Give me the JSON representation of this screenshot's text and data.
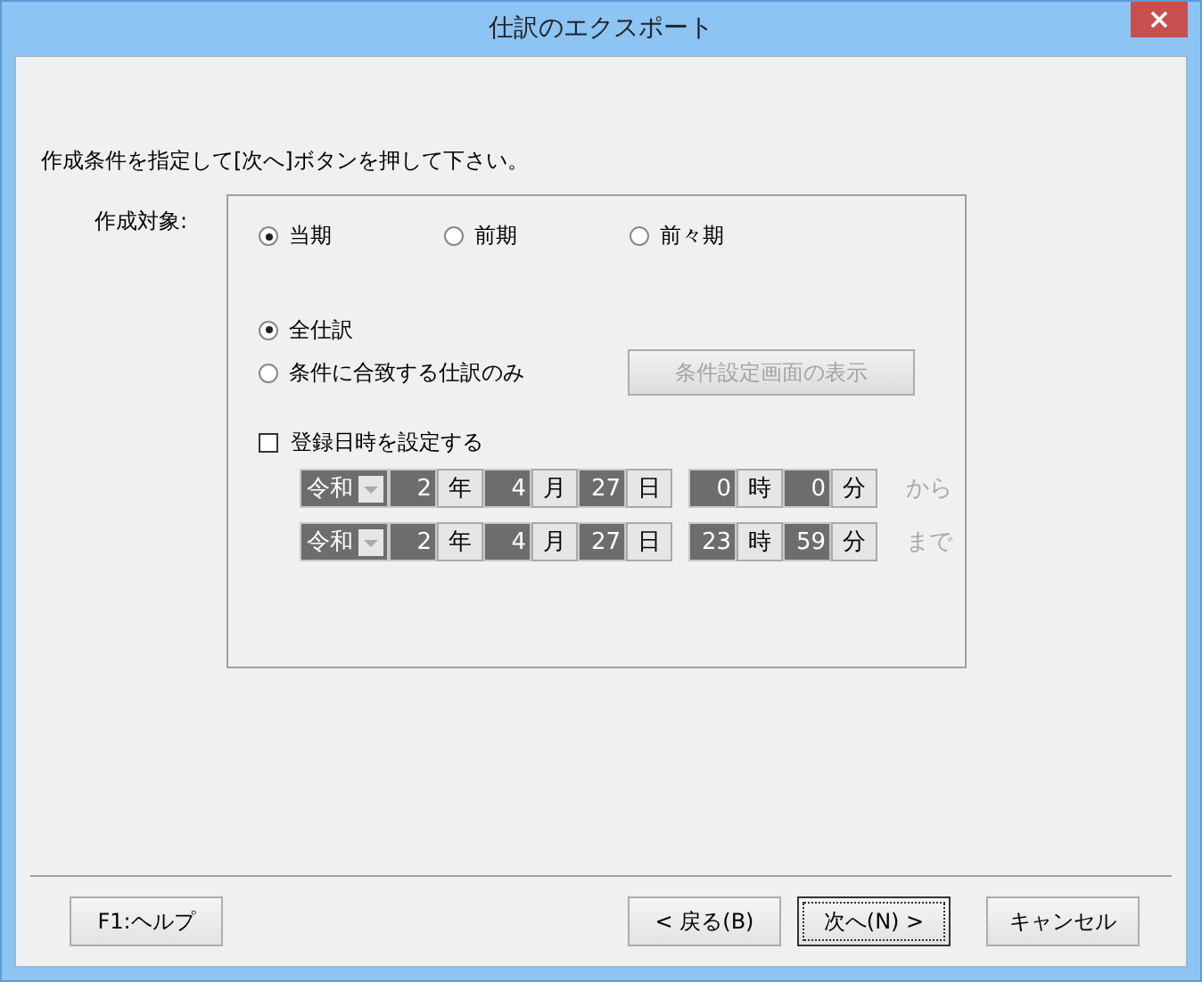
{
  "window": {
    "title": "仕訳のエクスポート"
  },
  "instruction": "作成条件を指定して[次へ]ボタンを押して下さい。",
  "target_label": "作成対象:",
  "period_options": [
    {
      "label": "当期",
      "selected": true
    },
    {
      "label": "前期",
      "selected": false
    },
    {
      "label": "前々期",
      "selected": false
    }
  ],
  "scope_options": [
    {
      "label": "全仕訳",
      "selected": true
    },
    {
      "label": "条件に合致する仕訳のみ",
      "selected": false
    }
  ],
  "condition_button": {
    "label": "条件設定画面の表示",
    "disabled": true
  },
  "date_checkbox": {
    "label": "登録日時を設定する",
    "checked": false
  },
  "date_rows": [
    {
      "date": [
        {
          "kind": "combo",
          "text": "令和"
        },
        {
          "kind": "value",
          "text": "2"
        },
        {
          "kind": "unit",
          "text": "年"
        },
        {
          "kind": "value",
          "text": "4"
        },
        {
          "kind": "unit",
          "text": "月"
        },
        {
          "kind": "value",
          "text": "27"
        },
        {
          "kind": "unit",
          "text": "日"
        }
      ],
      "time": [
        {
          "kind": "value",
          "text": "0"
        },
        {
          "kind": "unit",
          "text": "時"
        },
        {
          "kind": "value",
          "text": "0"
        },
        {
          "kind": "unit",
          "text": "分"
        }
      ],
      "suffix": "から"
    },
    {
      "date": [
        {
          "kind": "combo",
          "text": "令和"
        },
        {
          "kind": "value",
          "text": "2"
        },
        {
          "kind": "unit",
          "text": "年"
        },
        {
          "kind": "value",
          "text": "4"
        },
        {
          "kind": "unit",
          "text": "月"
        },
        {
          "kind": "value",
          "text": "27"
        },
        {
          "kind": "unit",
          "text": "日"
        }
      ],
      "time": [
        {
          "kind": "value",
          "text": "23"
        },
        {
          "kind": "unit",
          "text": "時"
        },
        {
          "kind": "value",
          "text": "59"
        },
        {
          "kind": "unit",
          "text": "分"
        }
      ],
      "suffix": "まで"
    }
  ],
  "buttons_left": [
    {
      "label": "F1:ヘルプ",
      "default": false
    }
  ],
  "buttons_right": [
    {
      "label": "< 戻る(B)",
      "default": false
    },
    {
      "label": "次へ(N) >",
      "default": true
    },
    {
      "label": "キャンセル",
      "default": false
    }
  ]
}
